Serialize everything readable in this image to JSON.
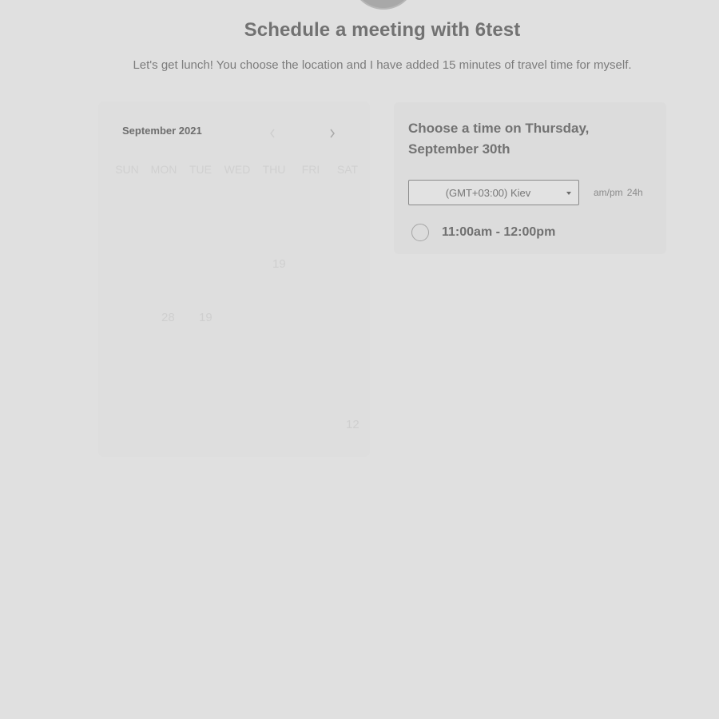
{
  "header": {
    "title": "Schedule a meeting with 6test",
    "subtitle": "Let's get lunch! You choose the location and I have added 15 minutes of travel time for myself."
  },
  "calendar": {
    "month": "September 2021",
    "prev_icon": "chevron-left-icon",
    "next_icon": "chevron-right-icon",
    "weekdays": [
      "SUN",
      "MON",
      "TUE",
      "WED",
      "THU",
      "FRI",
      "SAT"
    ],
    "visible_days": [
      "19",
      "28",
      "19",
      "12"
    ]
  },
  "time_panel": {
    "heading": "Choose a time on Thursday, September 30th",
    "timezone": {
      "selected": "(GMT+03:00) Kiev"
    },
    "format_options": [
      "am/pm",
      "24h"
    ],
    "slots": [
      {
        "label": "11:00am - 12:00pm"
      }
    ]
  }
}
